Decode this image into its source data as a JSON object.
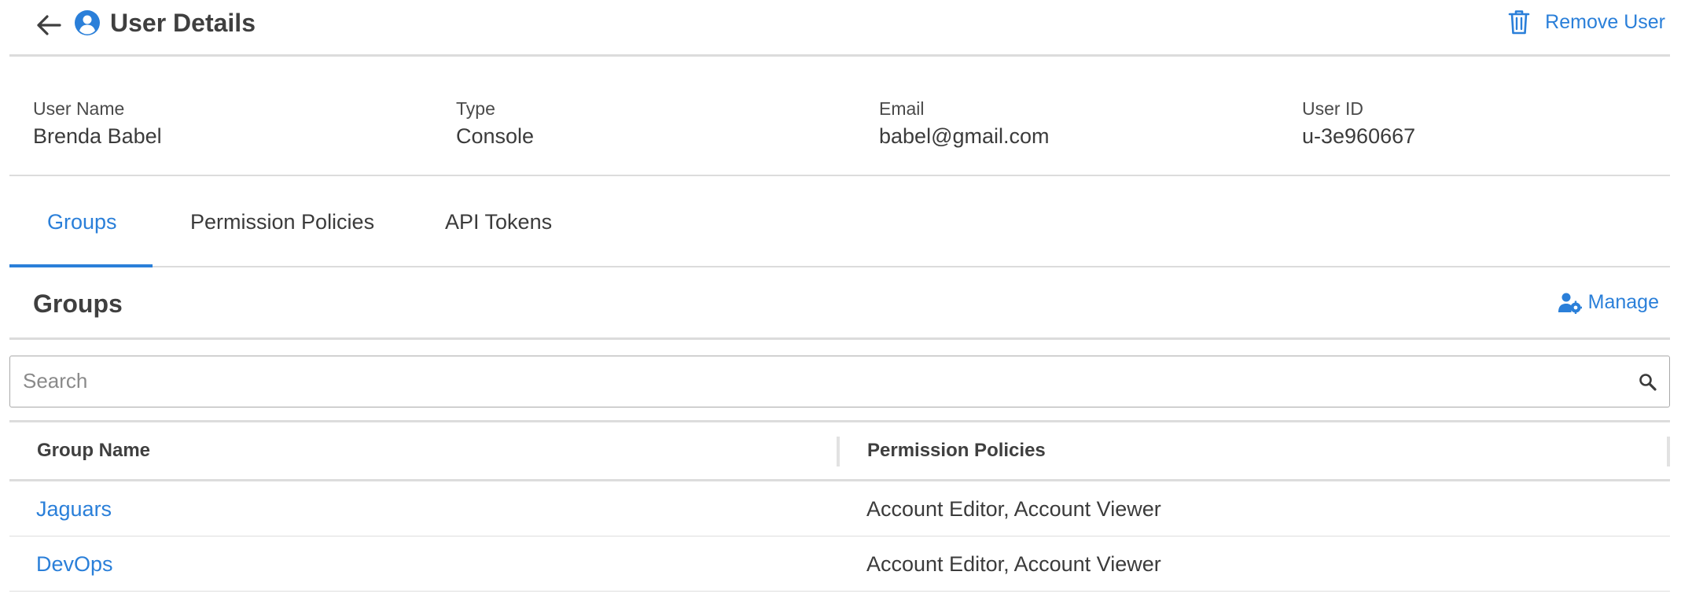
{
  "header": {
    "title": "User Details",
    "remove_label": "Remove User"
  },
  "details": [
    {
      "label": "User Name",
      "value": "Brenda Babel"
    },
    {
      "label": "Type",
      "value": "Console"
    },
    {
      "label": "Email",
      "value": "babel@gmail.com"
    },
    {
      "label": "User ID",
      "value": "u-3e960667"
    }
  ],
  "tabs": [
    {
      "label": "Groups",
      "active": true
    },
    {
      "label": "Permission Policies",
      "active": false
    },
    {
      "label": "API Tokens",
      "active": false
    }
  ],
  "section": {
    "title": "Groups",
    "manage_label": "Manage"
  },
  "search": {
    "placeholder": "Search",
    "value": ""
  },
  "table": {
    "columns": [
      "Group Name",
      "Permission Policies"
    ],
    "rows": [
      {
        "group": "Jaguars",
        "policies": "Account Editor, Account Viewer"
      },
      {
        "group": "DevOps",
        "policies": "Account Editor, Account Viewer"
      }
    ]
  },
  "colors": {
    "accent": "#2a7fd9",
    "text": "#3b3b3b",
    "divider": "#dcdcdc"
  },
  "icons": {
    "back": "arrow-left-icon",
    "user": "user-circle-icon",
    "remove": "trash-icon",
    "manage": "user-gear-icon",
    "search": "search-icon"
  }
}
